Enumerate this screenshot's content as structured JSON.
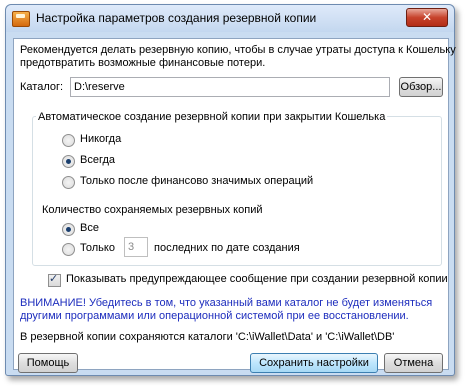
{
  "window": {
    "title": "Настройка параметров создания резервной копии",
    "close_glyph": "✕"
  },
  "intro_text_line1": "Рекомендуется делать резервную копию, чтобы в случае утраты доступа к Кошельку",
  "intro_text_line2": "предотвратить возможные финансовые потери.",
  "catalog": {
    "label": "Каталог:",
    "value": "D:\\reserve",
    "browse_label": "Обзор..."
  },
  "auto_backup": {
    "legend": "Автоматическое создание резервной копии при закрытии Кошелька",
    "options": [
      {
        "label": "Никогда",
        "checked": false
      },
      {
        "label": "Всегда",
        "checked": true
      },
      {
        "label": "Только после финансово значимых операций",
        "checked": false
      }
    ]
  },
  "keep_count": {
    "legend": "Количество сохраняемых резервных копий",
    "option_all": "Все",
    "option_only": "Только",
    "only_value": "3",
    "only_suffix": "последних по дате создания",
    "selected": "all"
  },
  "show_warning": {
    "label": "Показывать предупреждающее сообщение при создании резервной копии",
    "checked": true
  },
  "warning_line1": "ВНИМАНИЕ! Убедитесь в том, что указанный вами каталог не будет изменяться",
  "warning_line2": "другими программами или операционной системой при ее восстановлении.",
  "info_line": "В резервной копии сохраняются каталоги 'C:\\iWallet\\Data' и 'C:\\iWallet\\DB'",
  "buttons": {
    "help": "Помощь",
    "save": "Сохранить настройки",
    "cancel": "Отмена"
  },
  "colors": {
    "warning_text": "#1d2dbd",
    "title_bar": "#c9dcf1"
  }
}
